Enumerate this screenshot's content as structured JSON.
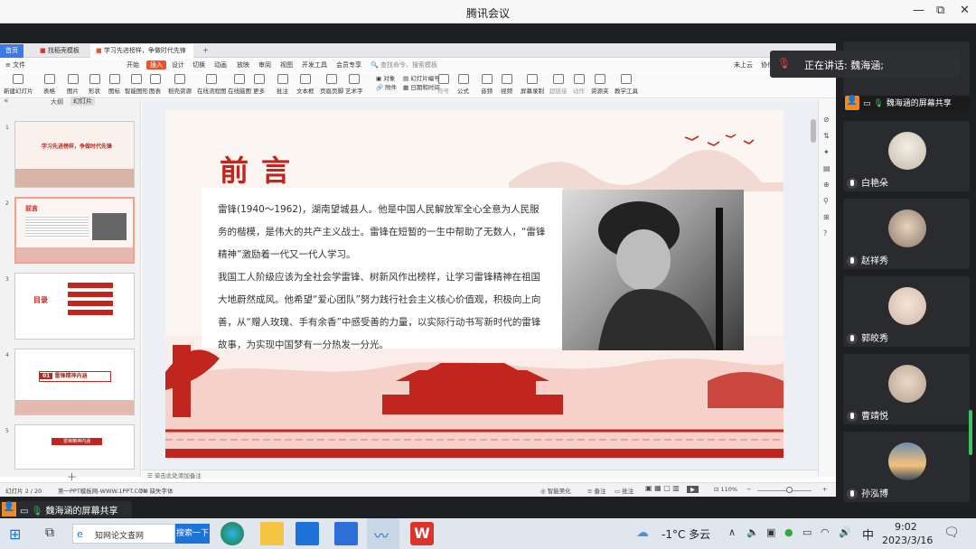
{
  "window": {
    "title": "腾讯会议"
  },
  "wps": {
    "tabs": [
      "首页",
      "找稻壳模板",
      "学习先进榜样，争做时代先锋"
    ],
    "menu": [
      "文件",
      "开始",
      "插入",
      "设计",
      "切换",
      "动画",
      "放映",
      "审阅",
      "视图",
      "开发工具",
      "会员专享"
    ],
    "search_placeholder": "查找命令、搜索模板",
    "right_menu": [
      "未上云",
      "协作",
      "分享"
    ],
    "ribbon": [
      "新建幻灯片",
      "表格",
      "图片",
      "形状",
      "图标",
      "智能图形",
      "图表",
      "稻壳资源",
      "在线流程图",
      "在线脑图",
      "更多",
      "批注",
      "文本框",
      "页眉页脚",
      "艺术字",
      "对象",
      "幻灯片编号",
      "附件",
      "日期和时间",
      "符号",
      "公式",
      "音频",
      "视频",
      "屏幕录制",
      "超链接",
      "动作",
      "资源夹",
      "教学工具"
    ],
    "pane_tabs": [
      "大纲",
      "幻灯片"
    ],
    "thumbs": [
      {
        "num": "1",
        "title": "学习先进榜样，争做时代先锋"
      },
      {
        "num": "2",
        "title": "前言"
      },
      {
        "num": "3",
        "title": "目录"
      },
      {
        "num": "4",
        "title": "雷锋精神内涵",
        "badge": "01"
      },
      {
        "num": "5",
        "title": "雷锋精神内涵"
      }
    ],
    "notes_placeholder": "单击此处添加备注",
    "status": {
      "slide": "幻灯片 2 / 20",
      "theme": "第一PPT模板网-WWW.1PPT.COM",
      "missing_font": "缺失字体",
      "smart": "智能美化",
      "notes": "备注",
      "comment": "批注",
      "zoom": "110%"
    }
  },
  "slide": {
    "title": "前言",
    "paragraphs": [
      "雷锋(1940～1962)，湖南望城县人。他是中国人民解放军全心全意为人民服务的楷模，是伟大的共产主义战士。雷锋在短暂的一生中帮助了无数人，“雷锋精神”激励着一代又一代人学习。",
      "我国工人阶级应该为全社会学雷锋、树新风作出榜样，让学习雷锋精神在祖国大地蔚然成风。他希望“爱心团队”努力践行社会主义核心价值观，积极向上向善，从“赠人玫瑰、手有余香”中感受善的力量，以实际行动书写新时代的雷锋故事，为实现中国梦有一分热发一分光。"
    ]
  },
  "meeting": {
    "speaking": "正在讲话: 魏海涵;",
    "share_label": "魏海涵的屏幕共享",
    "participants": [
      "魏海涵的屏幕共享",
      "白艳朵",
      "赵祥秀",
      "郭皎秀",
      "曹靖悦",
      "孙泓博"
    ],
    "bottom_share": "魏海涵的屏幕共享"
  },
  "taskbar": {
    "search_text": "知网论文查网",
    "search_button": "搜索一下",
    "weather": "-1°C 多云",
    "ime": "中",
    "time": "9:02",
    "date": "2023/3/16"
  }
}
